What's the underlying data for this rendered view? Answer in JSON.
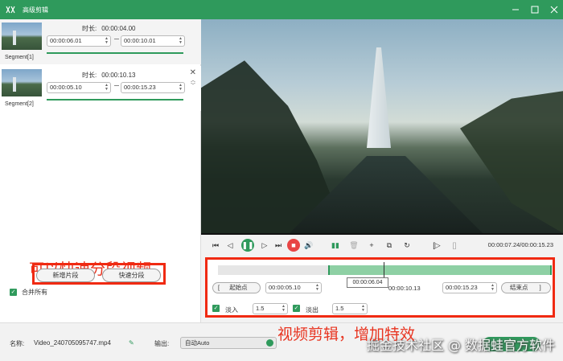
{
  "window": {
    "title": "高级剪辑"
  },
  "segments": [
    {
      "label": "Segment[1]",
      "duration_label": "时长:",
      "duration": "00:00:04.00",
      "start": "00:00:06.01",
      "end": "00:00:10.01"
    },
    {
      "label": "Segment[2]",
      "duration_label": "时长:",
      "duration": "00:00:10.13",
      "start": "00:00:05.10",
      "end": "00:00:15.23"
    }
  ],
  "left_buttons": {
    "new_segment": "新增片段",
    "quick_split": "快速分段"
  },
  "merge_all": {
    "label": "合并所有",
    "checked": true
  },
  "annotations": {
    "left": "可以快速分段视频",
    "bottom": "视频剪辑，增加特效"
  },
  "player": {
    "time_readout": "00:00:07.24/00:00:15.23"
  },
  "editor": {
    "playhead_tip": "00:00:06.04",
    "start_point_label": "起始点",
    "start_value": "00:00:05.10",
    "middle_value": "00:00:10.13",
    "end_value": "00:00:15.23",
    "end_point_label": "结束点",
    "fade_in_label": "淡入",
    "fade_in_value": "1.5",
    "fade_out_label": "淡出",
    "fade_out_value": "1.5",
    "bracket_left": "[",
    "bracket_right": "]"
  },
  "footer": {
    "name_label": "名称:",
    "file_name": "Video_240705095747.mp4",
    "output_label": "输出:",
    "output_value": "自动Auto",
    "watermark": "掘金技术社区 @ 数据蛙官方软件"
  },
  "colors": {
    "accent": "#2f9a5c",
    "annotation": "#e83420"
  }
}
